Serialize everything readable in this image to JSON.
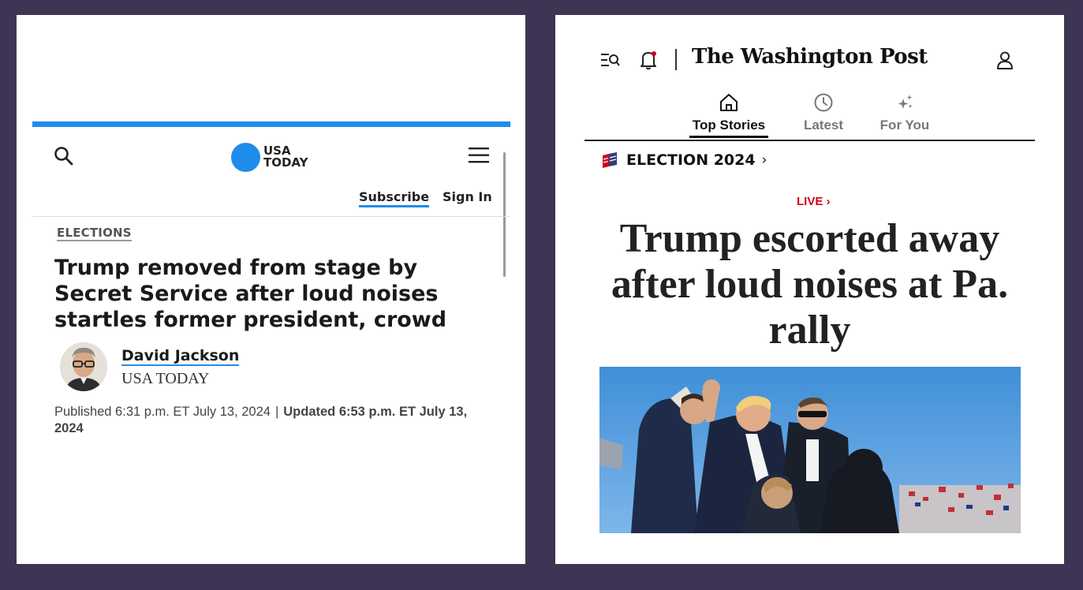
{
  "left": {
    "brand": {
      "line1": "USA",
      "line2": "TODAY"
    },
    "nav": {
      "subscribe": "Subscribe",
      "signin": "Sign In"
    },
    "section": "ELECTIONS",
    "headline": "Trump removed from stage by Secret Service after loud noises startles former president, crowd",
    "author": {
      "name": "David Jackson",
      "outlet": "USA TODAY"
    },
    "dates": {
      "published": "Published 6:31 p.m. ET July 13, 2024",
      "separator": "|",
      "updated": "Updated 6:53 p.m. ET July 13, 2024"
    },
    "icons": [
      "search-icon",
      "hamburger-menu-icon"
    ],
    "colors": {
      "accent": "#1f8ceb"
    }
  },
  "right": {
    "brand": "The Washington Post",
    "tabs": [
      {
        "label": "Top Stories",
        "icon": "home-icon",
        "active": true
      },
      {
        "label": "Latest",
        "icon": "clock-icon",
        "active": false
      },
      {
        "label": "For You",
        "icon": "sparkle-icon",
        "active": false
      }
    ],
    "section": {
      "label": "ELECTION 2024",
      "chevron": "›"
    },
    "live": "LIVE ›",
    "headline": "Trump escorted away after loud noises at Pa. rally",
    "icons": [
      "search-menu-icon",
      "bell-icon",
      "user-icon",
      "flag-icon"
    ],
    "colors": {
      "live": "#d0021b"
    }
  },
  "background_color": "#3d3553"
}
